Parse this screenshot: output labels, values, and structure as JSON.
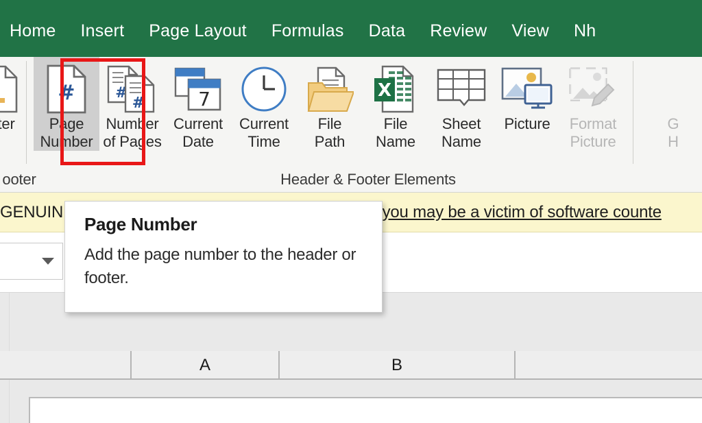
{
  "window": {
    "app": "Microsoft Excel",
    "accent_green": "#217346",
    "highlight_red": "#e81717",
    "banner_yellow": "#fbf6cd",
    "hover_gray": "#cfcfcf"
  },
  "ribbon_tabs": [
    {
      "label": "Home",
      "name": "tab-home"
    },
    {
      "label": "Insert",
      "name": "tab-insert"
    },
    {
      "label": "Page Layout",
      "name": "tab-page-layout"
    },
    {
      "label": "Formulas",
      "name": "tab-formulas"
    },
    {
      "label": "Data",
      "name": "tab-data"
    },
    {
      "label": "Review",
      "name": "tab-review"
    },
    {
      "label": "View",
      "name": "tab-view"
    },
    {
      "label": "Nh",
      "name": "tab-clipped"
    }
  ],
  "ribbon": {
    "group_label_left": "ooter",
    "group_label_elements": "Header & Footer Elements",
    "buttons": [
      {
        "label": "ooter",
        "name": "footer-button",
        "icon": "footer-page-icon",
        "disabled": false,
        "has_chevron": true,
        "highlighted": false
      },
      {
        "label": "Page\nNumber",
        "name": "page-number-button",
        "icon": "page-number-icon",
        "disabled": false,
        "has_chevron": false,
        "highlighted": true
      },
      {
        "label": "Number\nof Pages",
        "name": "number-of-pages-button",
        "icon": "number-of-pages-icon",
        "disabled": false,
        "has_chevron": false,
        "highlighted": false
      },
      {
        "label": "Current\nDate",
        "name": "current-date-button",
        "icon": "calendar-icon",
        "disabled": false,
        "has_chevron": false,
        "highlighted": false
      },
      {
        "label": "Current\nTime",
        "name": "current-time-button",
        "icon": "clock-icon",
        "disabled": false,
        "has_chevron": false,
        "highlighted": false
      },
      {
        "label": "File\nPath",
        "name": "file-path-button",
        "icon": "folder-document-icon",
        "disabled": false,
        "has_chevron": false,
        "highlighted": false
      },
      {
        "label": "File\nName",
        "name": "file-name-button",
        "icon": "excel-document-icon",
        "disabled": false,
        "has_chevron": false,
        "highlighted": false
      },
      {
        "label": "Sheet\nName",
        "name": "sheet-name-button",
        "icon": "sheet-grid-icon",
        "disabled": false,
        "has_chevron": false,
        "highlighted": false
      },
      {
        "label": "Picture",
        "name": "picture-button",
        "icon": "picture-icon",
        "disabled": false,
        "has_chevron": false,
        "highlighted": false
      },
      {
        "label": "Format\nPicture",
        "name": "format-picture-button",
        "icon": "format-picture-icon",
        "disabled": true,
        "has_chevron": false,
        "highlighted": false
      }
    ],
    "clipped_right_button": {
      "line1": "G",
      "line2": "H",
      "name": "go-to-header-button"
    }
  },
  "banner": {
    "left_text": "GENUIN",
    "right_text": "l you may be a victim of software counte"
  },
  "formula_bar": {
    "name_box_value": ""
  },
  "tooltip": {
    "title": "Page Number",
    "description": "Add the page number to the header or footer."
  },
  "sheet": {
    "columns": [
      "A",
      "B"
    ]
  }
}
